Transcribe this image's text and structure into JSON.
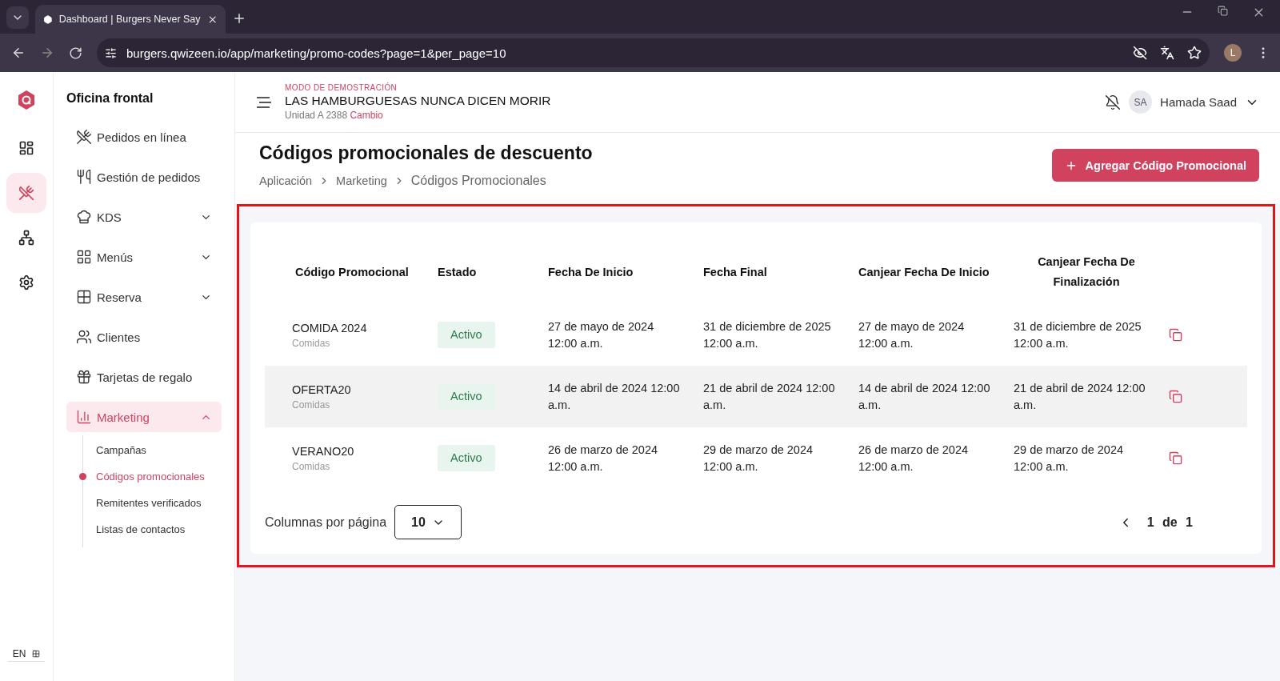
{
  "browser": {
    "tabs": [
      {
        "title": "Dashboard | Burgers Never Say",
        "selected": true
      }
    ],
    "url": "burgers.qwizeen.io/app/marketing/promo-codes?page=1&per_page=10",
    "profile_initial": "L"
  },
  "rail": {
    "items": [
      {
        "selected": false
      },
      {
        "selected": true
      },
      {
        "selected": false
      },
      {
        "selected": false
      }
    ],
    "language": "EN"
  },
  "sidebar": {
    "title": "Oficina frontal",
    "items": [
      {
        "label": "Pedidos en línea",
        "selected": false
      },
      {
        "label": "Gestión de pedidos",
        "selected": false
      },
      {
        "label": "KDS",
        "selected": false,
        "expanded": false
      },
      {
        "label": "Menús",
        "selected": false,
        "expanded": false
      },
      {
        "label": "Reserva",
        "selected": false,
        "expanded": false
      },
      {
        "label": "Clientes",
        "selected": false
      },
      {
        "label": "Tarjetas de regalo",
        "selected": false
      },
      {
        "label": "Marketing",
        "selected": true,
        "expanded": true,
        "children": [
          {
            "label": "Campañas",
            "selected": false
          },
          {
            "label": "Códigos promocionales",
            "selected": true
          },
          {
            "label": "Remitentes verificados",
            "selected": false
          },
          {
            "label": "Listas de contactos",
            "selected": false
          }
        ]
      }
    ]
  },
  "header": {
    "demo_label": "MODO DE DEMOSTRACIÓN",
    "restaurant": "LAS HAMBURGUESAS NUNCA DICEN MORIR",
    "unit": "Unidad A 2388",
    "change_link": "Cambio",
    "user_initials": "SA",
    "user_name": "Hamada Saad"
  },
  "page": {
    "title": "Códigos promocionales de descuento",
    "breadcrumbs": [
      "Aplicación",
      "Marketing",
      "Códigos Promocionales"
    ],
    "add_button": "Agregar Código Promocional"
  },
  "table": {
    "columns": [
      "Código Promocional",
      "Estado",
      "Fecha De Inicio",
      "Fecha Final",
      "Canjear Fecha De Inicio",
      "Canjear Fecha De Finalización"
    ],
    "rows": [
      {
        "code": "COMIDA 2024",
        "category": "Comidas",
        "status": "Activo",
        "start": "27 de mayo de 2024 12:00 a.m.",
        "end": "31 de diciembre de 2025 12:00 a.m.",
        "redeem_start": "27 de mayo de 2024 12:00 a.m.",
        "redeem_end": "31 de diciembre de 2025 12:00 a.m.",
        "highlighted": false
      },
      {
        "code": "OFERTA20",
        "category": "Comidas",
        "status": "Activo",
        "start": "14 de abril de 2024 12:00 a.m.",
        "end": "21 de abril de 2024 12:00 a.m.",
        "redeem_start": "14 de abril de 2024 12:00 a.m.",
        "redeem_end": "21 de abril de 2024 12:00 a.m.",
        "highlighted": true
      },
      {
        "code": "VERANO20",
        "category": "Comidas",
        "status": "Activo",
        "start": "26 de marzo de 2024 12:00 a.m.",
        "end": "29 de marzo de 2024 12:00 a.m.",
        "redeem_start": "26 de marzo de 2024 12:00 a.m.",
        "redeem_end": "29 de marzo de 2024 12:00 a.m.",
        "highlighted": false
      }
    ],
    "footer": {
      "rows_per_page_label": "Columnas por página",
      "rows_per_page": "10",
      "pagination": "1 de 1"
    }
  }
}
